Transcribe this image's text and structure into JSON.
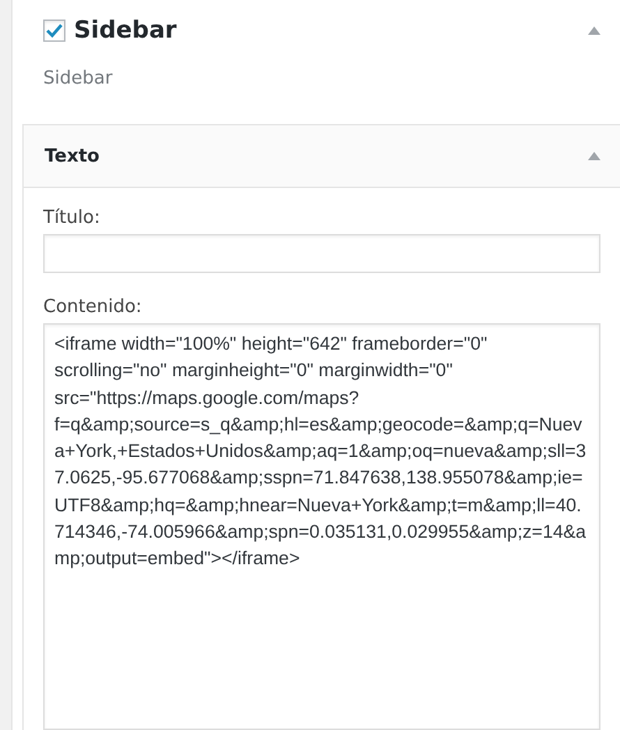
{
  "sidebar": {
    "title": "Sidebar",
    "checked": true,
    "expanded": true,
    "description": "Sidebar"
  },
  "widget": {
    "title": "Texto",
    "expanded": true,
    "fields": [
      {
        "kind": "input",
        "label": "Título:"
      },
      {
        "kind": "textarea",
        "label": "Contenido:",
        "value": "<iframe width=\"100%\" height=\"642\" frameborder=\"0\" scrolling=\"no\" marginheight=\"0\" marginwidth=\"0\" src=\"https://maps.google.com/maps?f=q&amp;source=s_q&amp;hl=es&amp;geocode=&amp;q=Nueva+York,+Estados+Unidos&amp;aq=1&amp;oq=nueva&amp;sll=37.0625,-95.677068&amp;sspn=71.847638,138.955078&amp;ie=UTF8&amp;hq=&amp;hnear=Nueva+York&amp;t=m&amp;ll=40.714346,-74.005966&amp;spn=0.035131,0.029955&amp;z=14&amp;output=embed\"></iframe>"
      }
    ]
  }
}
